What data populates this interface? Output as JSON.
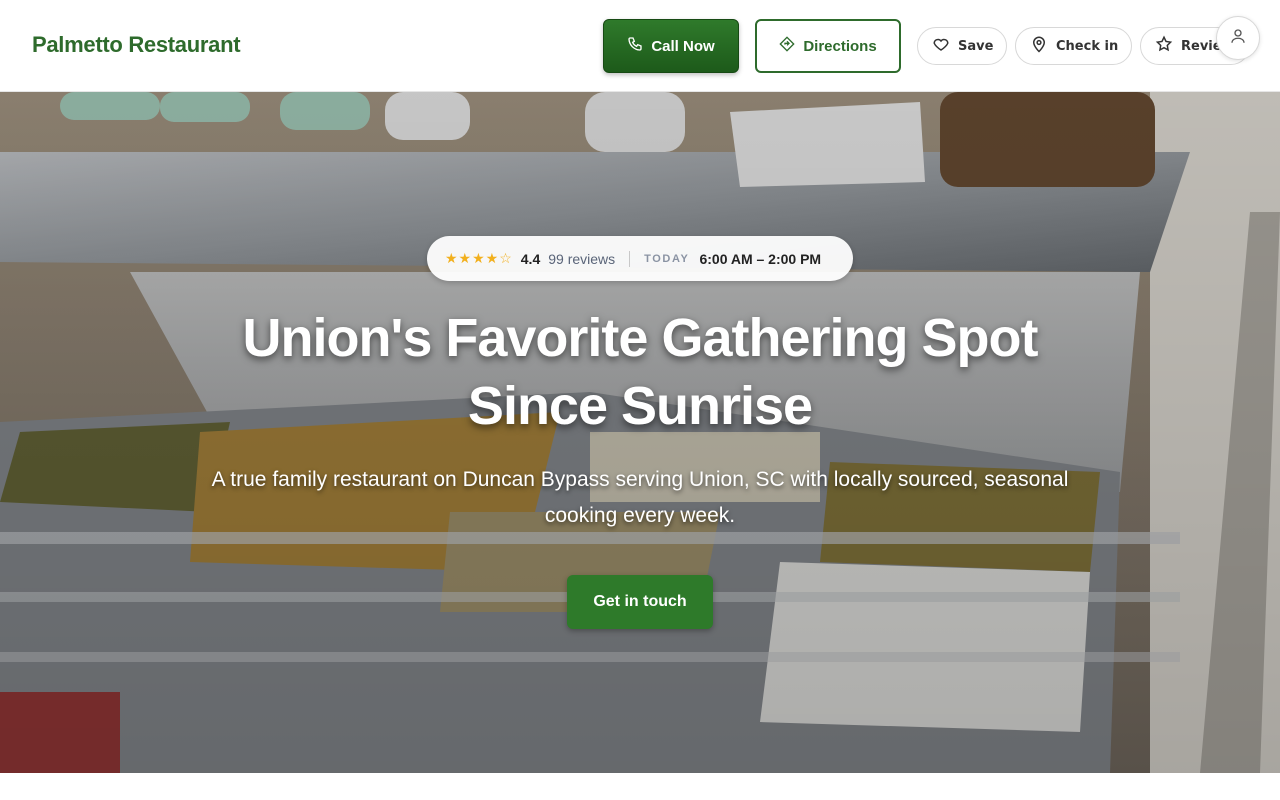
{
  "header": {
    "brand": "Palmetto Restaurant",
    "call_label": "Call Now",
    "directions_label": "Directions",
    "save_label": "Save",
    "checkin_label": "Check in",
    "review_label": "Reviews"
  },
  "hero": {
    "rating_stars": "★★★★☆",
    "rating": "4.4",
    "reviews": "99 reviews",
    "today_label": "TODAY",
    "hours": "6:00 AM – 2:00 PM",
    "headline_line1": "Union's Favorite Gathering Spot",
    "headline_line2": "Since Sunrise",
    "subtext": "A true family restaurant on Duncan Bypass serving Union, SC with locally sourced, seasonal cooking every week.",
    "cta_label": "Get in touch"
  },
  "icons": {
    "call": "phone-icon",
    "directions": "directions-icon",
    "save": "heart-icon",
    "checkin": "location-pin-icon",
    "review": "star-icon",
    "account": "user-icon"
  },
  "colors": {
    "brand_green": "#2e6b2c",
    "cta_green": "#2e7a2a",
    "star_gold": "#f2b01e"
  }
}
